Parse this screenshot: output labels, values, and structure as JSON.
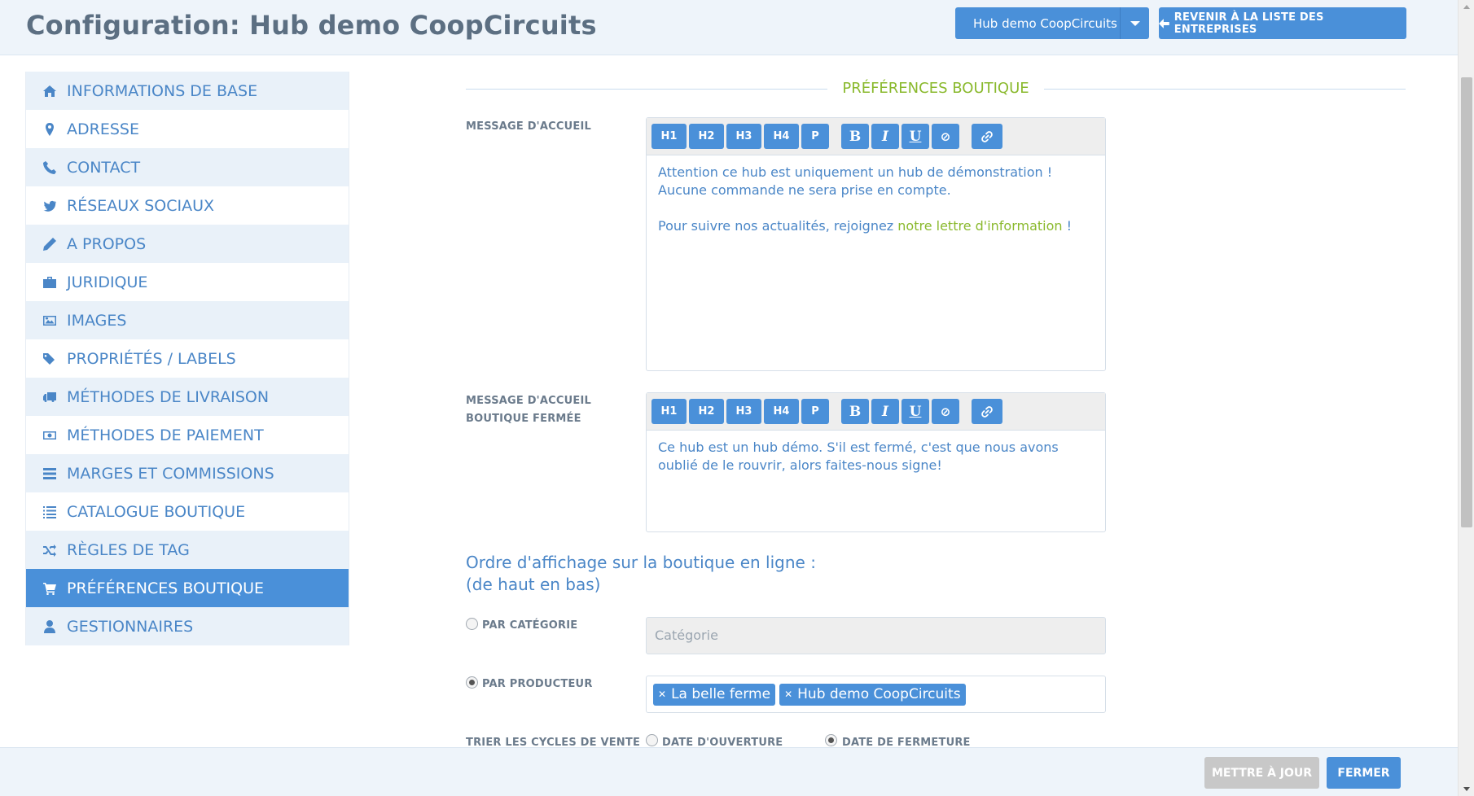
{
  "header": {
    "title": "Configuration: Hub demo CoopCircuits",
    "hub_select": "Hub demo CoopCircuits",
    "back_button": "REVENIR À LA LISTE DES ENTREPRISES"
  },
  "sidebar": {
    "items": [
      {
        "label": "INFORMATIONS DE BASE",
        "icon": "home-icon"
      },
      {
        "label": "ADRESSE",
        "icon": "map-marker-icon"
      },
      {
        "label": "CONTACT",
        "icon": "phone-icon"
      },
      {
        "label": "RÉSEAUX SOCIAUX",
        "icon": "twitter-icon"
      },
      {
        "label": "A PROPOS",
        "icon": "pencil-icon"
      },
      {
        "label": "JURIDIQUE",
        "icon": "briefcase-icon"
      },
      {
        "label": "IMAGES",
        "icon": "image-icon"
      },
      {
        "label": "PROPRIÉTÉS / LABELS",
        "icon": "tags-icon"
      },
      {
        "label": "MÉTHODES DE LIVRAISON",
        "icon": "truck-icon"
      },
      {
        "label": "MÉTHODES DE PAIEMENT",
        "icon": "money-icon"
      },
      {
        "label": "MARGES ET COMMISSIONS",
        "icon": "tasks-icon"
      },
      {
        "label": "CATALOGUE BOUTIQUE",
        "icon": "list-icon"
      },
      {
        "label": "RÈGLES DE TAG",
        "icon": "random-icon"
      },
      {
        "label": "PRÉFÉRENCES BOUTIQUE",
        "icon": "shopping-cart-icon",
        "active": true
      },
      {
        "label": "GESTIONNAIRES",
        "icon": "user-icon"
      }
    ]
  },
  "main": {
    "section_title": "PRÉFÉRENCES BOUTIQUE",
    "welcome": {
      "label": "MESSAGE D'ACCUEIL",
      "paragraph1": "Attention ce hub est uniquement un hub de démonstration ! Aucune commande ne sera prise en compte.",
      "paragraph2_prefix": "Pour suivre nos actualités, rejoignez ",
      "paragraph2_link": "notre lettre d'information",
      "paragraph2_suffix": " !"
    },
    "closed": {
      "label_line1": "MESSAGE D'ACCUEIL",
      "label_line2": "BOUTIQUE FERMÉE",
      "text": "Ce hub est un hub démo. S'il est fermé, c'est que nous avons oublié de le rouvrir, alors faites-nous signe!"
    },
    "toolbar": {
      "h1": "H1",
      "h2": "H2",
      "h3": "H3",
      "h4": "H4",
      "p": "P",
      "bold": "B",
      "italic": "I",
      "underline": "U",
      "clear": "⊘"
    },
    "order": {
      "heading_line1": "Ordre d'affichage sur la boutique en ligne :",
      "heading_line2": "(de haut en bas)",
      "by_category": "PAR CATÉGORIE",
      "category_placeholder": "Catégorie",
      "by_producer": "PAR PRODUCTEUR",
      "producers": [
        "La belle ferme",
        "Hub demo CoopCircuits"
      ],
      "selected": "by_producer"
    },
    "sort": {
      "label": "TRIER LES CYCLES DE VENTE",
      "opening": "DATE D'OUVERTURE",
      "closing": "DATE DE FERMETURE",
      "selected": "closing"
    }
  },
  "footer": {
    "update": "METTRE À JOUR",
    "close": "FERMER"
  },
  "colors": {
    "accent": "#4a90d9",
    "green": "#8ab92d",
    "sidebar_alt": "#e9f1f9"
  }
}
